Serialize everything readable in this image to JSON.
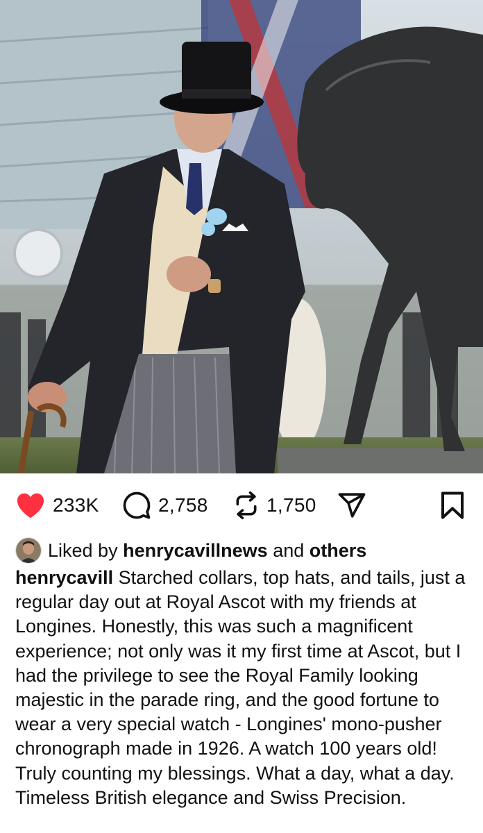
{
  "post": {
    "image_alt": "Man in black top hat and morning suit beside a horse statue at Royal Ascot"
  },
  "actions": {
    "like_count": "233K",
    "comment_count": "2,758",
    "repost_count": "1,750"
  },
  "likes": {
    "prefix": "Liked by",
    "user": "henrycavillnews",
    "joiner": "and",
    "others": "others"
  },
  "caption": {
    "username": "henrycavill",
    "text": "Starched collars, top hats, and tails, just a regular day out at Royal Ascot with my friends at Longines. Honestly, this was such a magnificent experience; not only was it my first time at Ascot, but I had the privilege to see the Royal Family looking majestic in the parade ring, and the good fortune to wear a very special watch - Longines' mono-pusher chronograph made in 1926. A watch 100 years old! Truly counting my blessings. What a day, what a day. Timeless British elegance and Swiss Precision."
  },
  "colors": {
    "like_red": "#ff3040",
    "text": "#111111"
  },
  "icons": {
    "like": "heart-icon",
    "comment": "comment-bubble-icon",
    "repost": "repost-icon",
    "share": "send-icon",
    "save": "bookmark-icon"
  }
}
